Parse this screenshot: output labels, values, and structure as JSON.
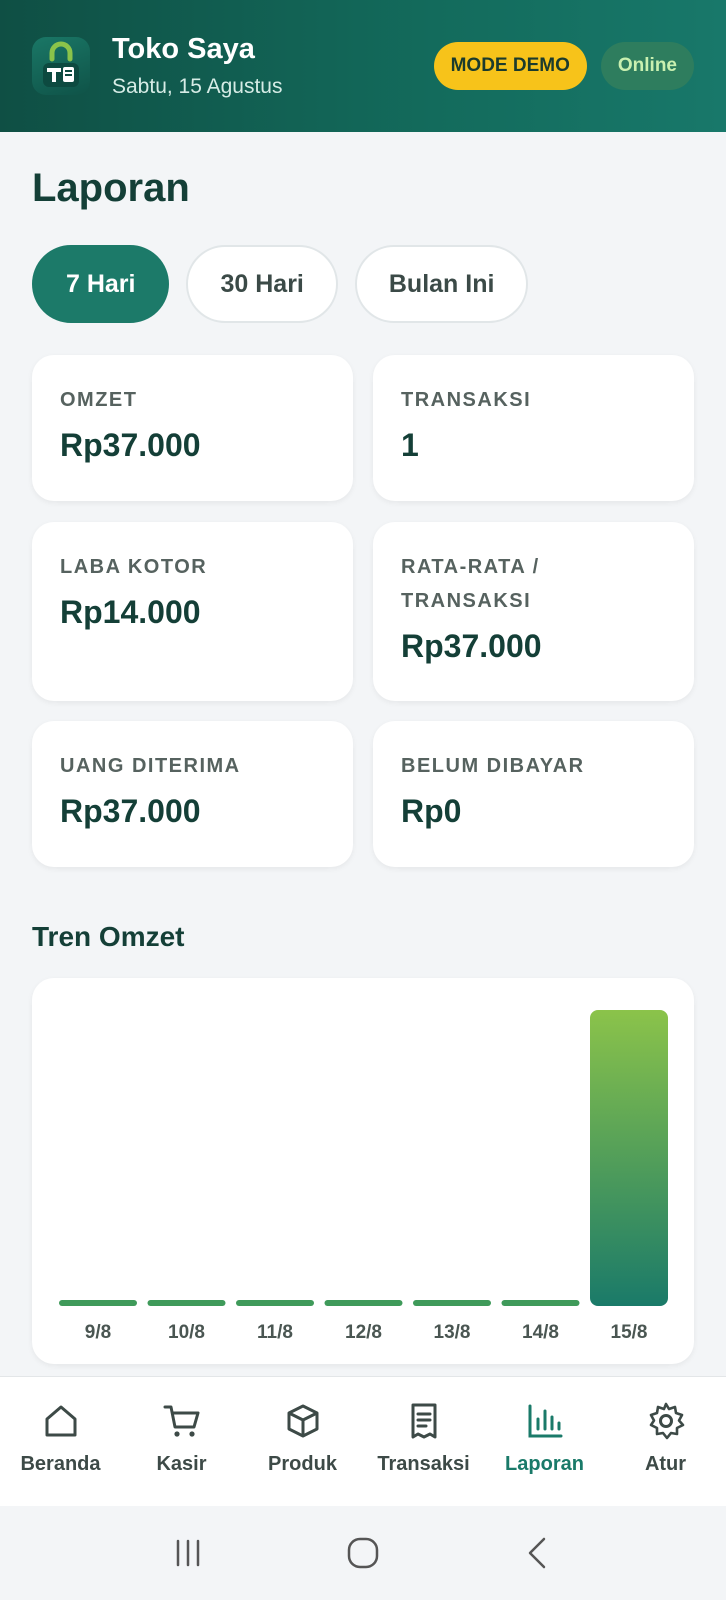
{
  "header": {
    "store_name": "Toko Saya",
    "date": "Sabtu, 15 Agustus",
    "demo_badge": "MODE DEMO",
    "online_badge": "Online",
    "logo_text": "T"
  },
  "page": {
    "title": "Laporan"
  },
  "ranges": [
    {
      "label": "7 Hari",
      "active": true
    },
    {
      "label": "30 Hari",
      "active": false
    },
    {
      "label": "Bulan Ini",
      "active": false
    }
  ],
  "stats": {
    "omzet": {
      "label": "OMZET",
      "value": "Rp37.000"
    },
    "transaksi": {
      "label": "TRANSAKSI",
      "value": "1"
    },
    "laba_kotor": {
      "label": "LABA KOTOR",
      "value": "Rp14.000"
    },
    "rata_rata": {
      "label": "RATA-RATA / TRANSAKSI",
      "value": "Rp37.000"
    },
    "uang_diterima": {
      "label": "UANG DITERIMA",
      "value": "Rp37.000"
    },
    "belum_dibayar": {
      "label": "BELUM DIBAYAR",
      "value": "Rp0"
    }
  },
  "trend": {
    "title": "Tren Omzet"
  },
  "chart_data": {
    "type": "bar",
    "categories": [
      "9/8",
      "10/8",
      "11/8",
      "12/8",
      "13/8",
      "14/8",
      "15/8"
    ],
    "values": [
      0,
      0,
      0,
      0,
      0,
      0,
      37000
    ],
    "title": "",
    "xlabel": "",
    "ylabel": "",
    "ylim": [
      0,
      37000
    ],
    "grid": false,
    "bar_color_top": "#8bc34a",
    "bar_color_bottom": "#1a7a69"
  },
  "nav": {
    "items": [
      {
        "key": "beranda",
        "label": "Beranda",
        "icon": "home-icon",
        "active": false
      },
      {
        "key": "kasir",
        "label": "Kasir",
        "icon": "cart-icon",
        "active": false
      },
      {
        "key": "produk",
        "label": "Produk",
        "icon": "box-icon",
        "active": false
      },
      {
        "key": "transaksi",
        "label": "Transaksi",
        "icon": "receipt-icon",
        "active": false
      },
      {
        "key": "laporan",
        "label": "Laporan",
        "icon": "bar-chart-icon",
        "active": true
      },
      {
        "key": "atur",
        "label": "Atur",
        "icon": "gear-icon",
        "active": false
      }
    ]
  },
  "colors": {
    "brand": "#1a7a69",
    "brand_dark": "#0f4f44",
    "demo_badge": "#f7c31a",
    "online_badge": "#2e7d5e"
  }
}
